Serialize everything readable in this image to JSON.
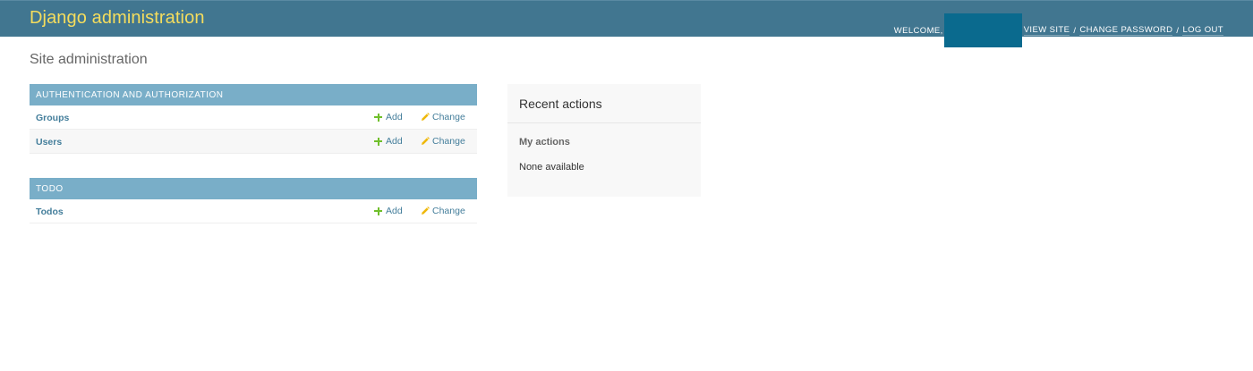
{
  "header": {
    "branding": "Django administration",
    "welcome": "WELCOME,",
    "links": [
      "VIEW SITE",
      "CHANGE PASSWORD",
      "LOG OUT"
    ],
    "separator": "/"
  },
  "page": {
    "title": "Site administration"
  },
  "modules": [
    {
      "caption": "AUTHENTICATION AND AUTHORIZATION",
      "rows": [
        {
          "name": "Groups",
          "add": "Add",
          "change": "Change"
        },
        {
          "name": "Users",
          "add": "Add",
          "change": "Change"
        }
      ]
    },
    {
      "caption": "TODO",
      "rows": [
        {
          "name": "Todos",
          "add": "Add",
          "change": "Change"
        }
      ]
    }
  ],
  "recent_actions": {
    "title": "Recent actions",
    "subtitle": "My actions",
    "empty": "None available"
  },
  "colors": {
    "header_bg": "#417690",
    "branding": "#f5dd5d",
    "module_caption": "#79aec8",
    "link": "#447e9b",
    "add_icon": "#70bf2b",
    "change_icon": "#efb80b"
  },
  "icons": {
    "add": "plus-icon",
    "change": "pencil-icon"
  }
}
